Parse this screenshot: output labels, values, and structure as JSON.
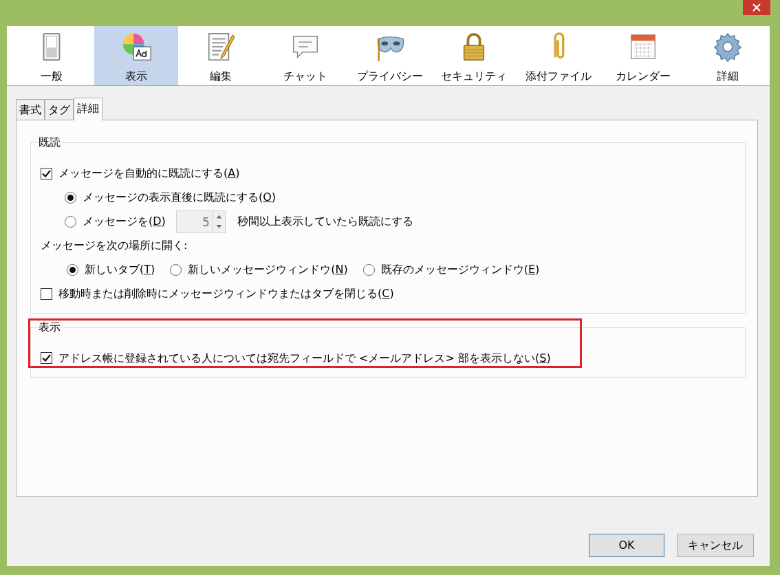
{
  "toolbar": [
    {
      "kind": "switch",
      "label": "一般",
      "selected": false
    },
    {
      "kind": "palette",
      "label": "表示",
      "selected": true
    },
    {
      "kind": "document",
      "label": "編集",
      "selected": false
    },
    {
      "kind": "chat",
      "label": "チャット",
      "selected": false
    },
    {
      "kind": "mask",
      "label": "プライバシー",
      "selected": false
    },
    {
      "kind": "lock",
      "label": "セキュリティ",
      "selected": false
    },
    {
      "kind": "clip",
      "label": "添付ファイル",
      "selected": false
    },
    {
      "kind": "calendar",
      "label": "カレンダー",
      "selected": false
    },
    {
      "kind": "gear",
      "label": "詳細",
      "selected": false
    }
  ],
  "subtabs": [
    {
      "label": "書式",
      "selected": false
    },
    {
      "label": "タグ",
      "selected": false
    },
    {
      "label": "詳細",
      "selected": true
    }
  ],
  "groups": [
    {
      "title": "既読",
      "highlighted": false,
      "rows": [
        {
          "kind": "checkbox",
          "checked": true,
          "before": "メッセージを自動的に既読にする(",
          "key": "A",
          "after": ")",
          "children": [
            {
              "kind": "radio",
              "selected": true,
              "before": "メッセージの表示直後に既読にする(",
              "key": "O",
              "after": ")"
            },
            {
              "kind": "radio_spin",
              "selected": false,
              "before": "メッセージを(",
              "key": "D",
              "after": ")",
              "spin": {
                "value": "5",
                "disabled": true
              },
              "trailing": "秒間以上表示していたら既読にする"
            }
          ]
        },
        {
          "kind": "label",
          "text": "メッセージを次の場所に開く:",
          "children": [
            {
              "kind": "radio_group",
              "options": [
                {
                  "selected": true,
                  "before": "新しいタブ(",
                  "key": "T",
                  "after": ")"
                },
                {
                  "selected": false,
                  "before": "新しいメッセージウィンドウ(",
                  "key": "N",
                  "after": ")"
                },
                {
                  "selected": false,
                  "before": "既存のメッセージウィンドウ(",
                  "key": "E",
                  "after": ")"
                }
              ]
            }
          ]
        },
        {
          "kind": "checkbox",
          "checked": false,
          "before": "移動時または削除時にメッセージウィンドウまたはタブを閉じる(",
          "key": "C",
          "after": ")"
        }
      ]
    },
    {
      "title": "表示",
      "highlighted": true,
      "rows": [
        {
          "kind": "checkbox",
          "checked": true,
          "before": "アドレス帳に登録されている人については宛先フィールドで <メールアドレス> 部を表示しない(",
          "key": "S",
          "after": ")"
        }
      ]
    }
  ],
  "buttons": [
    {
      "label": "OK",
      "default": true
    },
    {
      "label": "キャンセル",
      "default": false
    }
  ]
}
